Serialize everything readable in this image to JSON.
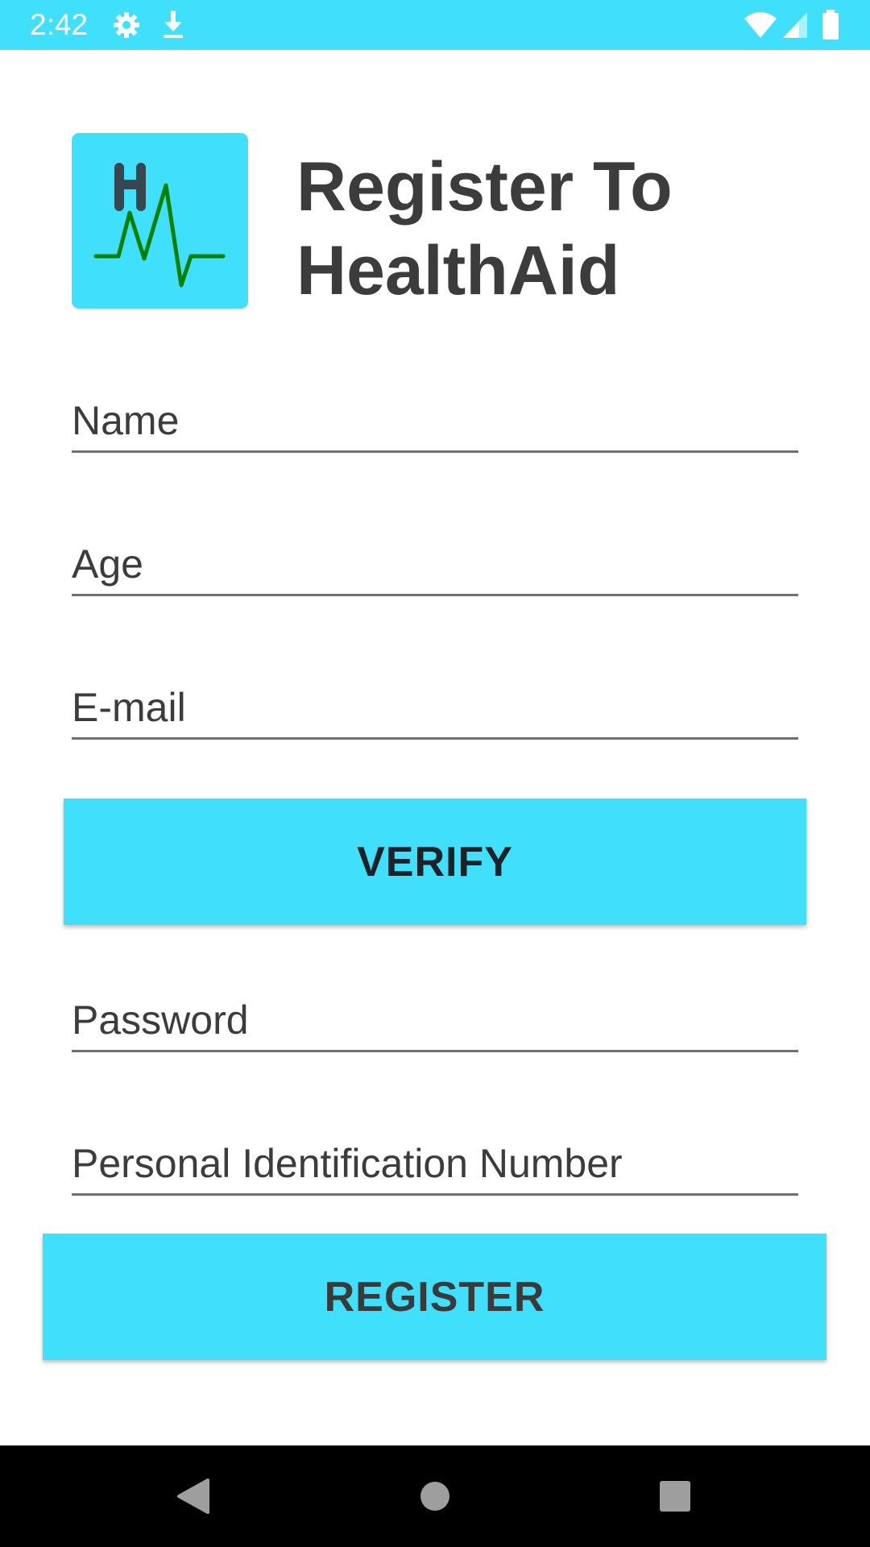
{
  "status_bar": {
    "time": "2:42",
    "icons": [
      "gear-icon",
      "download-icon",
      "wifi-icon",
      "signal-icon",
      "battery-icon"
    ],
    "background": "#40e0fd"
  },
  "header": {
    "title": "Register To HealthAid",
    "logo": {
      "letter": "H",
      "icon": "heartbeat-logo-icon",
      "tile_color": "#40e0fd",
      "pulse_color": "#008000"
    }
  },
  "form": {
    "name_placeholder": "Name",
    "age_placeholder": "Age",
    "email_placeholder": "E-mail",
    "verify_label": "VERIFY",
    "password_placeholder": "Password",
    "pin_placeholder": "Personal Identification Number",
    "register_label": "REGISTER"
  },
  "nav_bar": {
    "buttons": [
      "back-icon",
      "home-icon",
      "recents-icon"
    ]
  },
  "colors": {
    "accent": "#40e0fd",
    "text": "#3c3c3c"
  }
}
